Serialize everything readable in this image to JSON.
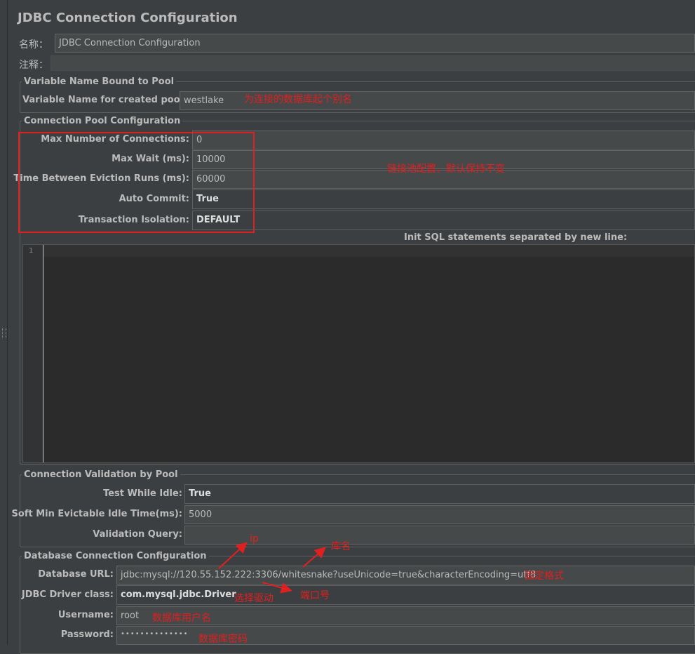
{
  "header": {
    "title": "JDBC Connection Configuration"
  },
  "name_label": "名称：",
  "name_value": "JDBC Connection Configuration",
  "comment_label": "注释：",
  "variable_group": {
    "title": "Variable Name Bound to Pool",
    "label": "Variable Name for created pool:",
    "value": "westlake",
    "annotation": "为连接的数据库起个别名"
  },
  "pool_group": {
    "title": "Connection Pool Configuration",
    "max_conn_label": "Max Number of Connections:",
    "max_conn_value": "0",
    "max_wait_label": "Max Wait (ms):",
    "max_wait_value": "10000",
    "eviction_label": "Time Between Eviction Runs (ms):",
    "eviction_value": "60000",
    "auto_commit_label": "Auto Commit:",
    "auto_commit_value": "True",
    "isolation_label": "Transaction Isolation:",
    "isolation_value": "DEFAULT",
    "annotation": "链接池配置，默认保持不变",
    "init_sql_label": "Init SQL statements separated by new line:",
    "line_number": "1"
  },
  "validation_group": {
    "title": "Connection Validation by Pool",
    "test_idle_label": "Test While Idle:",
    "test_idle_value": "True",
    "soft_min_label": "Soft Min Evictable Idle Time(ms):",
    "soft_min_value": "5000",
    "query_label": "Validation Query:",
    "query_value": ""
  },
  "db_group": {
    "title": "Database Connection Configuration",
    "url_label": "Database URL:",
    "url_value": "jdbc:mysql://120.55.152.222:3306/whitesnake?useUnicode=true&characterEncoding=utf8",
    "driver_label": "JDBC Driver class:",
    "driver_value": "com.mysql.jdbc.Driver",
    "username_label": "Username:",
    "username_value": "root",
    "password_label": "Password:",
    "password_value": "••••••••••••••"
  },
  "annotations": {
    "ip": "ip",
    "db_name": "库名",
    "fixed_format": "固定格式",
    "port": "端口号",
    "select_driver": "选择驱动",
    "db_user": "数据库用户名",
    "db_password": "数据库密码"
  },
  "colors": {
    "background": "#3c3f41",
    "field": "#45494a",
    "editor": "#2b2b2b",
    "annotation": "#e02020",
    "text": "#bbbbbb"
  }
}
